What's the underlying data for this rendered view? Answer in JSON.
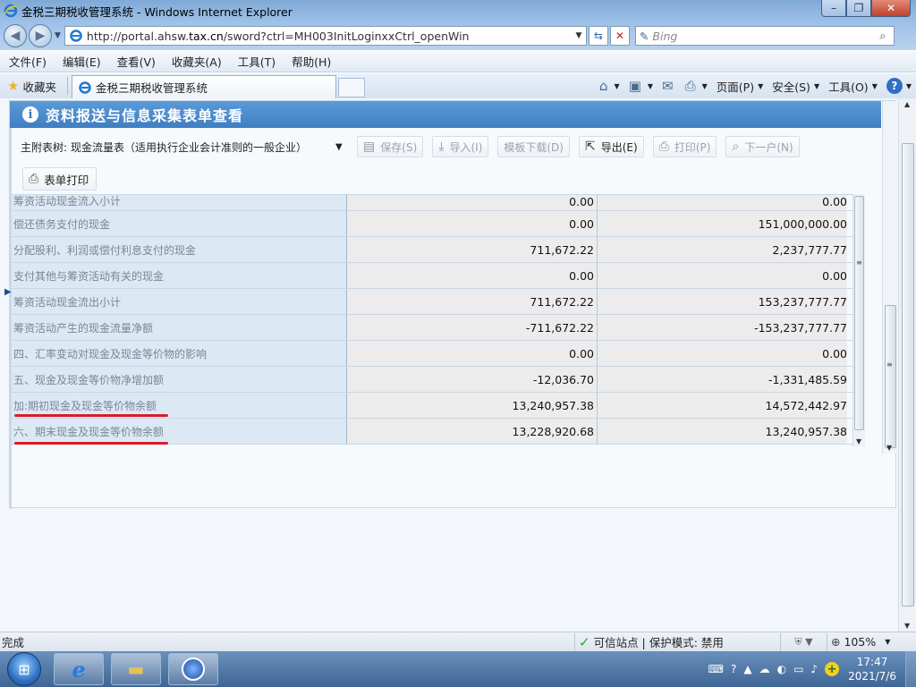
{
  "window": {
    "title": "金税三期税收管理系统 - Windows Internet Explorer",
    "min": "–",
    "max": "❐",
    "close": "✕"
  },
  "address": {
    "url_prefix": "http://portal.ahsw.",
    "url_domain": "tax.cn",
    "url_suffix": "/sword?ctrl=MH003InitLoginxxCtrl_openWin",
    "search_placeholder": "Bing"
  },
  "menu": [
    "文件(F)",
    "编辑(E)",
    "查看(V)",
    "收藏夹(A)",
    "工具(T)",
    "帮助(H)"
  ],
  "favorites_label": "收藏夹",
  "tab_label": "金税三期税收管理系统",
  "commands": {
    "page": "页面(P)",
    "safety": "安全(S)",
    "tools": "工具(O)",
    "help": "?"
  },
  "panel": {
    "title": "资料报送与信息采集表单查看",
    "form_label": "主附表树:",
    "form_value": "现金流量表（适用执行企业会计准则的一般企业）",
    "buttons": {
      "save": "保存(S)",
      "import": "导入(I)",
      "template": "模板下载(D)",
      "export": "导出(E)",
      "print": "打印(P)",
      "next": "下一户(N)"
    },
    "form_print": "表单打印"
  },
  "grid": {
    "rows": [
      {
        "name": "筹资活动现金流入小计",
        "current": "0.00",
        "previous": "0.00"
      },
      {
        "name": "偿还债务支付的现金",
        "current": "0.00",
        "previous": "151,000,000.00"
      },
      {
        "name": "分配股利、利润或偿付利息支付的现金",
        "current": "711,672.22",
        "previous": "2,237,777.77"
      },
      {
        "name": "支付其他与筹资活动有关的现金",
        "current": "0.00",
        "previous": "0.00"
      },
      {
        "name": "筹资活动现金流出小计",
        "current": "711,672.22",
        "previous": "153,237,777.77"
      },
      {
        "name": "筹资活动产生的现金流量净额",
        "current": "-711,672.22",
        "previous": "-153,237,777.77"
      },
      {
        "name": "四、汇率变动对现金及现金等价物的影响",
        "current": "0.00",
        "previous": "0.00"
      },
      {
        "name": "五、现金及现金等价物净增加额",
        "current": "-12,036.70",
        "previous": "-1,331,485.59"
      },
      {
        "name": "加:期初现金及现金等价物余额",
        "current": "13,240,957.38",
        "previous": "14,572,442.97"
      },
      {
        "name": "六、期末现金及现金等价物余额",
        "current": "13,228,920.68",
        "previous": "13,240,957.38"
      }
    ]
  },
  "status": {
    "done": "完成",
    "trust": "可信站点 | 保护模式: 禁用",
    "zoom": "105%"
  },
  "clock": {
    "time": "17:47",
    "date": "2021/7/6"
  },
  "colors": {
    "header_blue": "#3f7fc2",
    "highlight_red": "#d91b2b"
  }
}
